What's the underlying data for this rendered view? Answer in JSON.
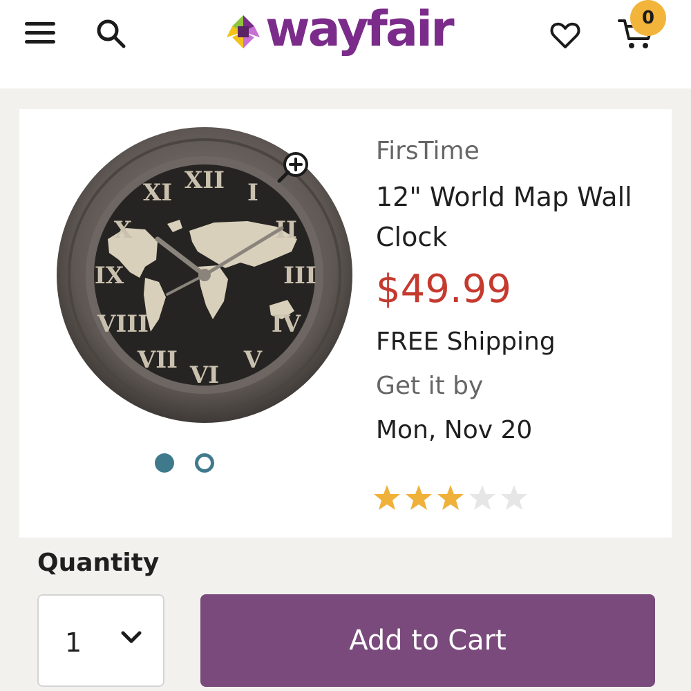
{
  "header": {
    "logo_text": "wayfair",
    "cart_count": "0",
    "icons": [
      "hamburger-menu-icon",
      "search-icon",
      "heart-icon",
      "cart-icon"
    ]
  },
  "product": {
    "brand": "FirsTime",
    "title": "12\" World Map Wall Clock",
    "price": "$49.99",
    "shipping": "FREE Shipping",
    "delivery_label": "Get it by",
    "delivery_date": "Mon, Nov 20",
    "rating": 3,
    "rating_max": 5,
    "image_count": 2,
    "active_image": 1
  },
  "purchase": {
    "quantity_label": "Quantity",
    "quantity_value": "1",
    "add_to_cart_label": "Add to Cart"
  },
  "colors": {
    "brand_purple": "#7b2c8a",
    "button_purple": "#7a4a7c",
    "price_red": "#c53a2f",
    "badge_yellow": "#f2b43a",
    "dot_teal": "#3f7a8c",
    "star_gold": "#f0b13b",
    "star_gray": "#e6e6e6"
  }
}
